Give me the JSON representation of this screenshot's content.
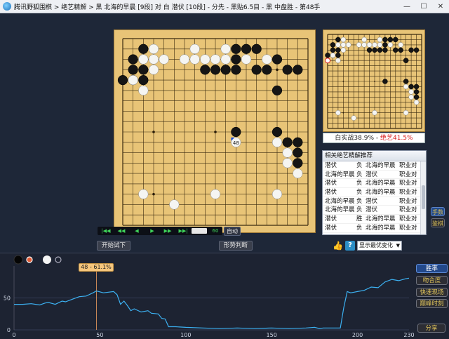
{
  "window": {
    "title": "腾讯野狐围棋 > 绝艺精解 > 黑 北海的早晨 [9段] 对 白 潜伏 [10段] - 分先 - 黑贴6.5目 - 黑 中盘胜 - 第48手",
    "minimize": "—",
    "maximize": "☐",
    "close": "✕"
  },
  "board": {
    "move_label": "48",
    "black_stones": [
      [
        2,
        1
      ],
      [
        11,
        1
      ],
      [
        12,
        1
      ],
      [
        13,
        1
      ],
      [
        1,
        2
      ],
      [
        11,
        2
      ],
      [
        2,
        3
      ],
      [
        1,
        3
      ],
      [
        2,
        2
      ],
      [
        8,
        3
      ],
      [
        9,
        3
      ],
      [
        10,
        3
      ],
      [
        11,
        3
      ],
      [
        13,
        3
      ],
      [
        14,
        3
      ],
      [
        15,
        2
      ],
      [
        16,
        3
      ],
      [
        17,
        3
      ],
      [
        0,
        4
      ],
      [
        1,
        4
      ],
      [
        2,
        4
      ],
      [
        15,
        5
      ],
      [
        11,
        9
      ],
      [
        15,
        9
      ],
      [
        16,
        10
      ],
      [
        17,
        10
      ],
      [
        17,
        11
      ],
      [
        17,
        12
      ]
    ],
    "white_stones": [
      [
        3,
        1
      ],
      [
        7,
        1
      ],
      [
        10,
        1
      ],
      [
        2,
        2
      ],
      [
        3,
        2
      ],
      [
        4,
        2
      ],
      [
        6,
        2
      ],
      [
        7,
        2
      ],
      [
        8,
        2
      ],
      [
        9,
        2
      ],
      [
        10,
        2
      ],
      [
        12,
        2
      ],
      [
        14,
        2
      ],
      [
        3,
        3
      ],
      [
        1,
        4
      ],
      [
        2,
        5
      ],
      [
        11,
        10
      ],
      [
        15,
        10
      ],
      [
        16,
        11
      ],
      [
        16,
        12
      ],
      [
        17,
        13
      ],
      [
        2,
        15
      ],
      [
        5,
        16
      ],
      [
        9,
        15
      ],
      [
        15,
        15
      ]
    ],
    "last_move": [
      11,
      10
    ]
  },
  "mini_board": {
    "black_stones": [
      [
        2,
        1
      ],
      [
        11,
        1
      ],
      [
        12,
        1
      ],
      [
        13,
        1
      ],
      [
        1,
        2
      ],
      [
        11,
        2
      ],
      [
        2,
        3
      ],
      [
        1,
        3
      ],
      [
        8,
        3
      ],
      [
        9,
        3
      ],
      [
        10,
        3
      ],
      [
        11,
        3
      ],
      [
        13,
        3
      ],
      [
        14,
        3
      ],
      [
        16,
        3
      ],
      [
        17,
        3
      ],
      [
        0,
        4
      ],
      [
        1,
        4
      ],
      [
        2,
        4
      ],
      [
        15,
        5
      ],
      [
        11,
        9
      ],
      [
        15,
        9
      ],
      [
        16,
        10
      ],
      [
        17,
        10
      ],
      [
        17,
        11
      ],
      [
        17,
        12
      ]
    ],
    "white_stones": [
      [
        3,
        1
      ],
      [
        7,
        1
      ],
      [
        10,
        1
      ],
      [
        2,
        2
      ],
      [
        3,
        2
      ],
      [
        4,
        2
      ],
      [
        6,
        2
      ],
      [
        7,
        2
      ],
      [
        8,
        2
      ],
      [
        9,
        2
      ],
      [
        10,
        2
      ],
      [
        12,
        2
      ],
      [
        14,
        2
      ],
      [
        3,
        3
      ],
      [
        1,
        4
      ],
      [
        2,
        5
      ],
      [
        15,
        10
      ],
      [
        16,
        11
      ],
      [
        16,
        12
      ],
      [
        17,
        13
      ],
      [
        2,
        15
      ],
      [
        5,
        16
      ],
      [
        9,
        15
      ],
      [
        15,
        15
      ]
    ],
    "red_marker": [
      0,
      5
    ]
  },
  "score": {
    "white_label": "白实战38.9%",
    "separator": "-",
    "black_label": "绝艺41.5%"
  },
  "recommendations": {
    "header": "相关绝艺精解推荐",
    "rows": [
      [
        "潜伏",
        "负",
        "北海的早晨",
        "职业对"
      ],
      [
        "北海的早晨",
        "负",
        "潜伏",
        "职业对"
      ],
      [
        "潜伏",
        "负",
        "北海的早晨",
        "职业对"
      ],
      [
        "潜伏",
        "负",
        "北海的早晨",
        "职业对"
      ],
      [
        "北海的早晨",
        "负",
        "潜伏",
        "职业对"
      ],
      [
        "北海的早晨",
        "负",
        "潜伏",
        "职业对"
      ],
      [
        "潜伏",
        "胜",
        "北海的早晨",
        "职业对"
      ],
      [
        "潜伏",
        "负",
        "北海的早晨",
        "职业对"
      ]
    ]
  },
  "side_tabs": {
    "tab1": "手数",
    "tab2": "鉴棋"
  },
  "nav": {
    "first": "|◀◀",
    "fast_back": "◀◀",
    "back": "◀",
    "play": "▶",
    "fast_fwd": "▶▶",
    "last": "▶▶|",
    "sixty": "60",
    "auto_label": "自动"
  },
  "buttons": {
    "trial": "开始试下",
    "judge": "形势判断",
    "variation": "显示最优变化"
  },
  "graph": {
    "tooltip": "48 - 61.1%",
    "side_buttons": [
      "胜率",
      "吻合度",
      "快速现场",
      "巅峰时刻"
    ],
    "share": "分享",
    "colors": {
      "line": "#3cb1f2",
      "grid": "#3b4560",
      "marker": "#f0a060"
    }
  },
  "chart_data": {
    "type": "line",
    "x": [
      0,
      230
    ],
    "xticks": [
      0,
      50,
      100,
      150,
      200,
      230
    ],
    "yticks": [
      0,
      50
    ],
    "ylim": [
      0,
      100
    ],
    "xlim": [
      0,
      230
    ],
    "series": [
      {
        "values": [
          [
            0,
            40
          ],
          [
            5,
            40
          ],
          [
            10,
            41
          ],
          [
            15,
            39
          ],
          [
            18,
            42
          ],
          [
            20,
            43
          ],
          [
            24,
            40
          ],
          [
            28,
            45
          ],
          [
            30,
            44
          ],
          [
            34,
            48
          ],
          [
            38,
            52
          ],
          [
            42,
            53
          ],
          [
            46,
            58
          ],
          [
            48,
            61
          ],
          [
            52,
            58
          ],
          [
            55,
            59
          ],
          [
            58,
            60
          ],
          [
            60,
            55
          ],
          [
            62,
            40
          ],
          [
            64,
            45
          ],
          [
            66,
            38
          ],
          [
            68,
            30
          ],
          [
            70,
            33
          ],
          [
            74,
            28
          ],
          [
            78,
            30
          ],
          [
            80,
            26
          ],
          [
            84,
            25
          ],
          [
            86,
            18
          ],
          [
            88,
            17
          ],
          [
            90,
            5
          ],
          [
            94,
            5
          ],
          [
            100,
            4
          ],
          [
            110,
            3
          ],
          [
            120,
            2
          ],
          [
            130,
            3
          ],
          [
            140,
            2
          ],
          [
            150,
            3
          ],
          [
            160,
            2
          ],
          [
            170,
            3
          ],
          [
            175,
            4
          ],
          [
            178,
            2
          ],
          [
            180,
            3
          ],
          [
            185,
            3
          ],
          [
            190,
            3
          ],
          [
            192,
            35
          ],
          [
            194,
            60
          ],
          [
            196,
            58
          ],
          [
            198,
            59
          ],
          [
            200,
            60
          ],
          [
            204,
            62
          ],
          [
            208,
            67
          ],
          [
            212,
            66
          ],
          [
            216,
            75
          ],
          [
            220,
            79
          ],
          [
            224,
            77
          ],
          [
            228,
            80
          ],
          [
            230,
            81
          ]
        ]
      }
    ],
    "marker_x": 48
  }
}
